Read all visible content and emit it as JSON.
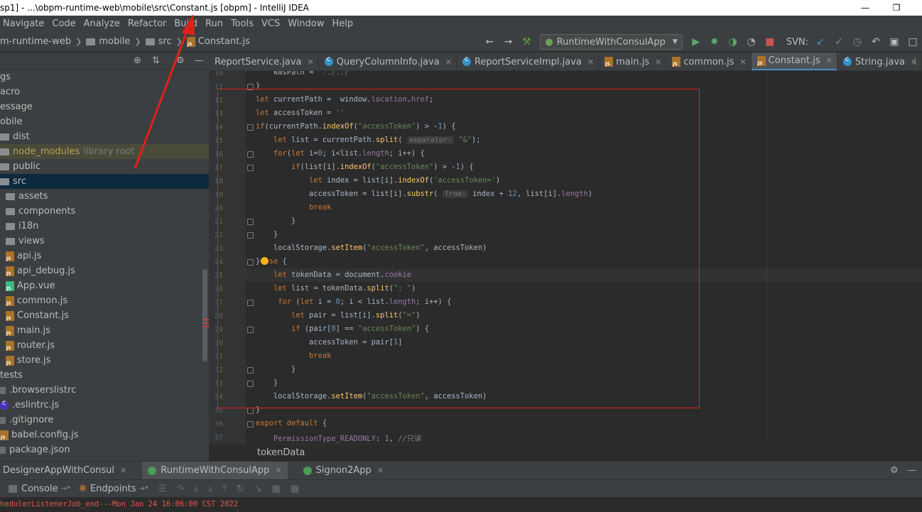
{
  "window": {
    "title": "sp1] - ...\\obpm-runtime-web\\mobile\\src\\Constant.js [obpm] - IntelliJ IDEA"
  },
  "menu": [
    "Navigate",
    "Code",
    "Analyze",
    "Refactor",
    "Build",
    "Run",
    "Tools",
    "VCS",
    "Window",
    "Help"
  ],
  "breadcrumb": {
    "module": "m-runtime-web",
    "folder1": "mobile",
    "folder2": "src",
    "file": "Constant.js"
  },
  "toolbar": {
    "run_config": "RuntimeWithConsulApp",
    "svn_label": "SVN:"
  },
  "tree": [
    {
      "label": "gs"
    },
    {
      "label": "acro"
    },
    {
      "label": "essage"
    },
    {
      "label": "obile"
    },
    {
      "label": "dist"
    },
    {
      "label": "node_modules",
      "suffix": "library root"
    },
    {
      "label": "public"
    },
    {
      "label": "src"
    },
    {
      "label": "assets"
    },
    {
      "label": "components"
    },
    {
      "label": "i18n"
    },
    {
      "label": "views"
    },
    {
      "label": "api.js"
    },
    {
      "label": "api_debug.js"
    },
    {
      "label": "App.vue"
    },
    {
      "label": "common.js"
    },
    {
      "label": "Constant.js"
    },
    {
      "label": "main.js"
    },
    {
      "label": "router.js"
    },
    {
      "label": "store.js"
    },
    {
      "label": "tests"
    },
    {
      "label": ".browserslistrc"
    },
    {
      "label": ".eslintrc.js"
    },
    {
      "label": ".gitignore"
    },
    {
      "label": "babel.config.js"
    },
    {
      "label": "package.json"
    }
  ],
  "tabs": [
    {
      "label": "ReportService.java"
    },
    {
      "label": "QueryColumnInfo.java"
    },
    {
      "label": "ReportServiceImpl.java"
    },
    {
      "label": "main.js"
    },
    {
      "label": "common.js"
    },
    {
      "label": "Constant.js"
    },
    {
      "label": "String.java"
    }
  ],
  "editor": {
    "line_numbers": [
      "10",
      "11",
      "12",
      "13",
      "14",
      "15",
      "16",
      "17",
      "18",
      "19",
      "20",
      "21",
      "22",
      "23",
      "24",
      "25",
      "26",
      "27",
      "28",
      "29",
      "30",
      "31",
      "32",
      "33",
      "34",
      "35",
      "36",
      "37"
    ],
    "bottom_crumb": "tokenData"
  },
  "run": {
    "tabs": [
      "DesignerAppWithConsul",
      "RuntimeWithConsulApp",
      "Signon2App"
    ],
    "console_tab": "Console",
    "endpoints_tab": "Endpoints",
    "output": "hedulerListenerJob_end---Mon Jan 24 16:06:00 CST 2022"
  }
}
